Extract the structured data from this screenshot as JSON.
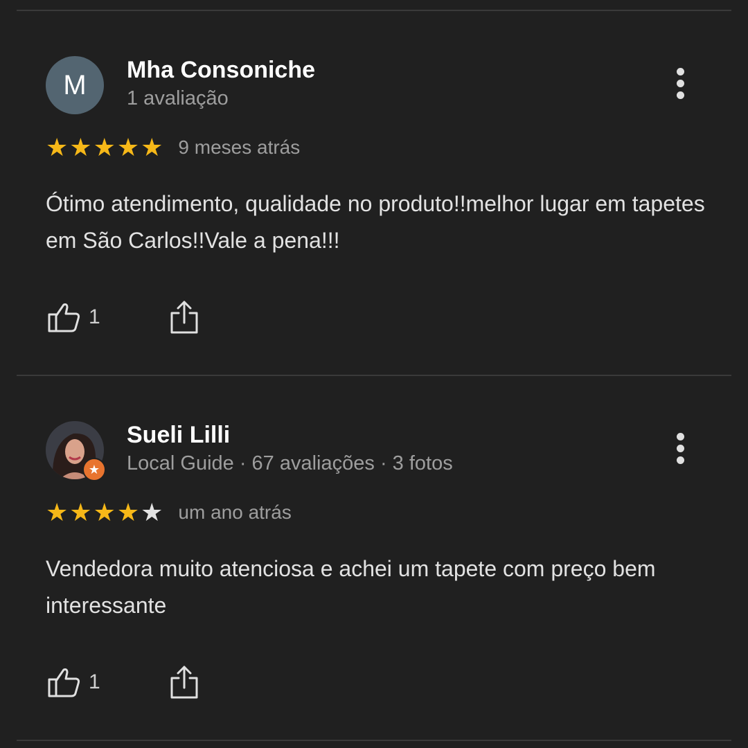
{
  "reviews": [
    {
      "author": "Mha Consoniche",
      "avatar_letter": "M",
      "meta": "1 avaliação",
      "rating": 5,
      "time": "9 meses atrás",
      "text": "Ótimo atendimento, qualidade no produto!!melhor lugar em tapetes em São Carlos!!Vale a pena!!!",
      "likes": "1",
      "icons": [
        "thumbs-up-icon",
        "share-icon",
        "more-vert-icon",
        "star-icon"
      ]
    },
    {
      "author": "Sueli Lilli",
      "meta": "Local Guide · 67 avaliações · 3 fotos",
      "rating": 4,
      "time": "um ano atrás",
      "text": "Vendedora muito atenciosa e achei um tapete com preço bem interessante",
      "likes": "1",
      "icons": [
        "thumbs-up-icon",
        "share-icon",
        "more-vert-icon",
        "star-icon",
        "local-guide-badge-icon"
      ]
    }
  ],
  "colors": {
    "background": "#202020",
    "star_filled": "#f6b818",
    "star_empty": "#e2e2e2",
    "avatar_bg": "#536571",
    "guide_badge": "#e8742f",
    "divider": "#3a3a3a"
  }
}
